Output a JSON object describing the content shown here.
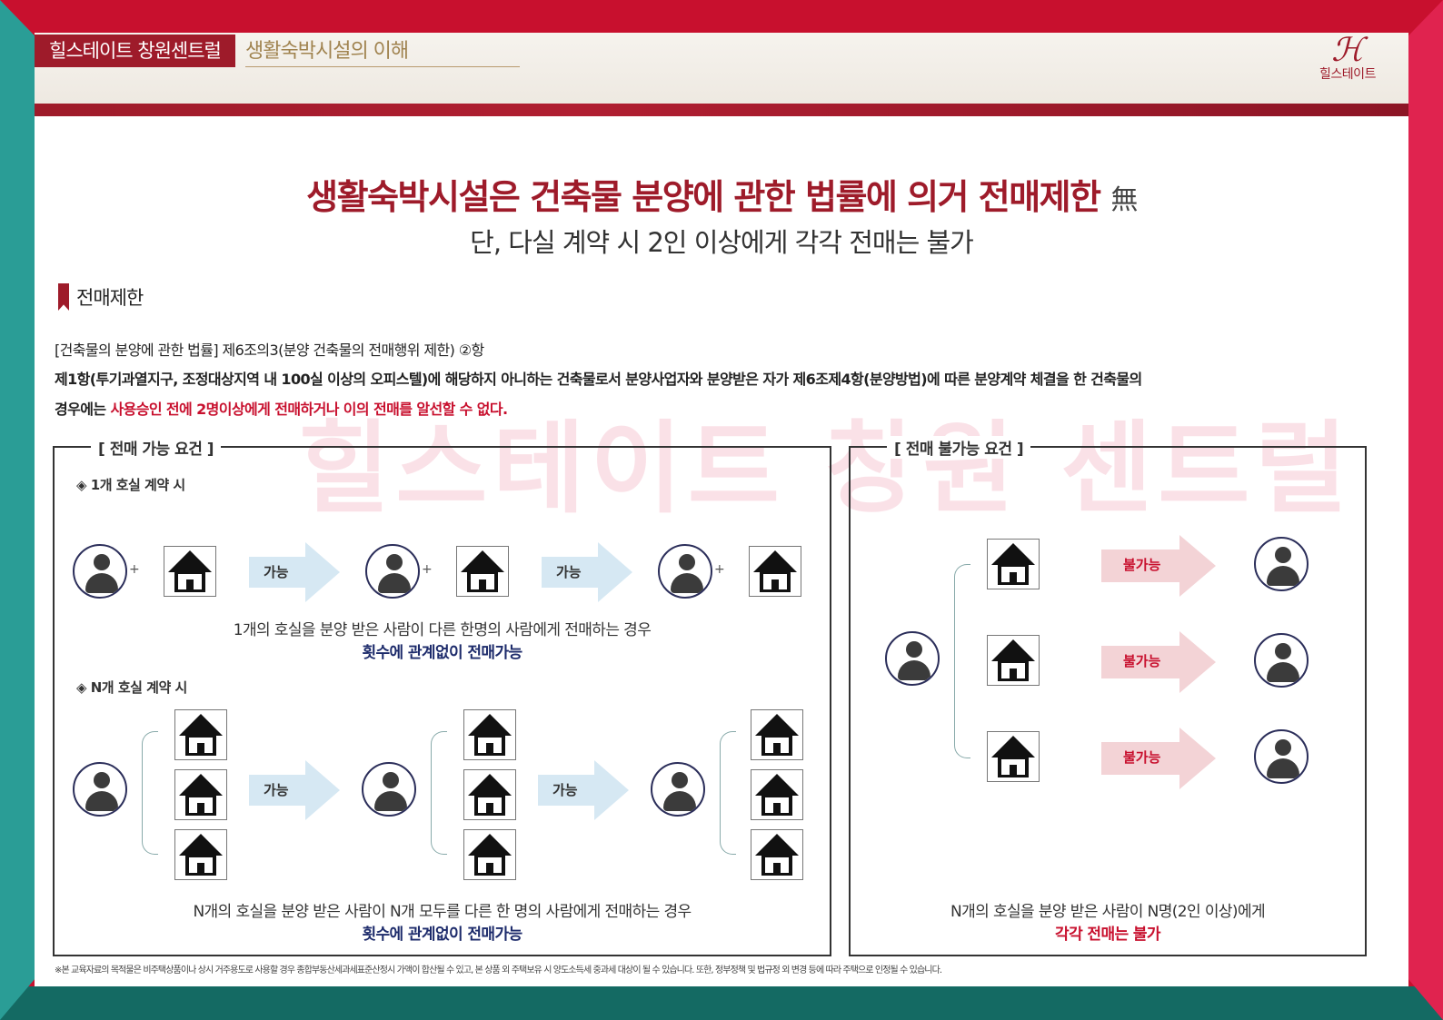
{
  "header": {
    "brand": "힐스테이트 창원센트럴",
    "section": "생활숙박시설의 이해",
    "logo_text": "힐스테이트"
  },
  "headline": {
    "main": "생활숙박시설은 건축물 분양에 관한 법률에 의거 전매제한",
    "mark": "無",
    "sub": "단, 다실 계약 시 2인 이상에게 각각 전매는 불가"
  },
  "section_title": "전매제한",
  "law": {
    "ref": "[건축물의 분양에 관한 법률] 제6조의3(분양 건축물의 전매행위 제한) ②항",
    "body1": "제1항(투기과열지구, 조정대상지역 내 100실 이상의 오피스텔)에 해당하지 아니하는 건축물로서 분양사업자와 분양받은 자가 제6조제4항(분양방법)에 따른 분양계약 체결을 한 건축물의",
    "body2_prefix": "경우에는 ",
    "body2_red": "사용승인 전에 2명이상에게 전매하거나 이의 전매를 알선할 수 없다."
  },
  "watermark": "힐스테이트 창원 센트럴",
  "possible_box": {
    "title": "[ 전매 가능 요건 ]",
    "single": {
      "label": "◈ 1개 호실 계약 시",
      "arrow_label": "가능",
      "caption": "1개의 호실을 분양 받은 사람이 다른 한명의 사람에게 전매하는 경우",
      "caption_emph": "횟수에 관계없이 전매가능"
    },
    "multi": {
      "label": "◈ N개 호실 계약 시",
      "arrow_label": "가능",
      "caption": "N개의 호실을 분양 받은 사람이 N개 모두를 다른 한 명의 사람에게 전매하는 경우",
      "caption_emph": "횟수에 관계없이 전매가능"
    },
    "plus": "+"
  },
  "impossible_box": {
    "title": "[ 전매 불가능 요건 ]",
    "arrow_label": "불가능",
    "caption": "N개의 호실을 분양 받은 사람이 N명(2인 이상)에게",
    "caption_emph": "각각 전매는 불가"
  },
  "footnote": "※본 교육자료의 목적물은 비주택상품이나 상시 거주용도로 사용할 경우 종합부동산세과세표준산정시 가액이 합산될 수 있고, 본 상품 외 주택보유 시 양도소득세 중과세 대상이 될 수 있습니다. 또한, 정부정책 및 법규정 외 변경 등에 따라 주택으로 인정될 수 있습니다.",
  "colors": {
    "brand_red": "#9e1b2a",
    "accent_red": "#c8102e",
    "teal": "#2a9d96",
    "caption_blue": "#1d2b6b",
    "arrow_blue": "#d6e8f3",
    "arrow_red": "#f3d3d6"
  }
}
